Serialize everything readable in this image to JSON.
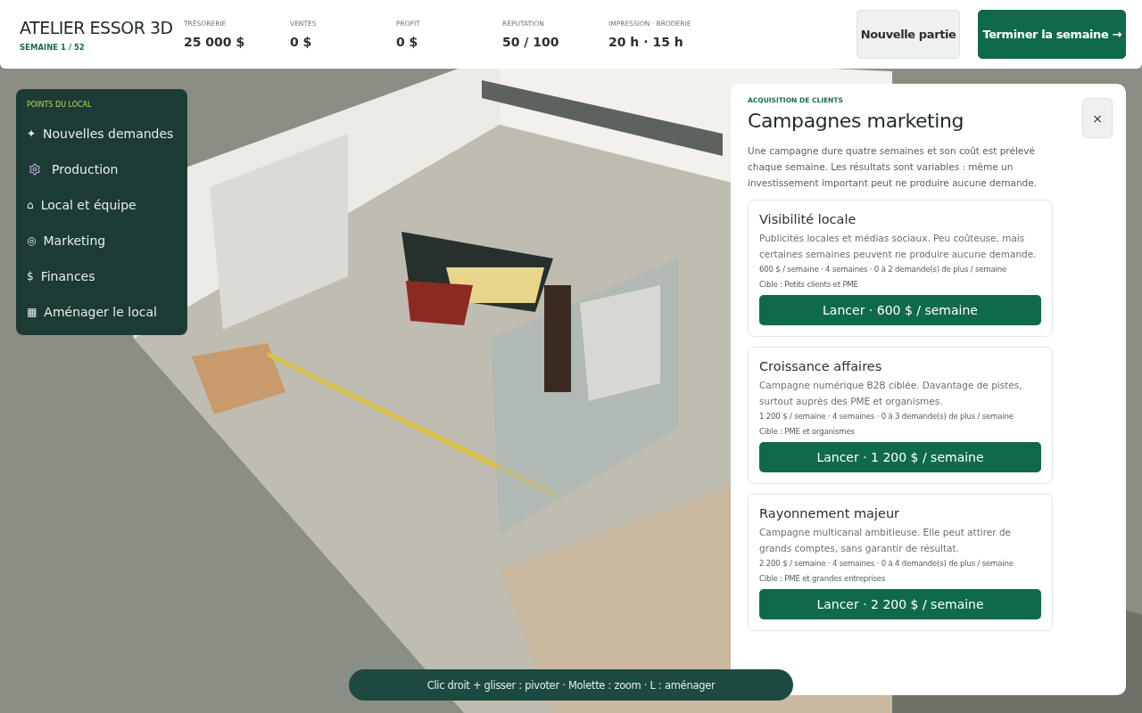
{
  "header": {
    "title": "ATELIER ESSOR 3D",
    "week": "SEMAINE 1 / 52",
    "stats": [
      {
        "label": "TRÉSORERIE",
        "value": "25 000 $"
      },
      {
        "label": "VENTES",
        "value": "0 $"
      },
      {
        "label": "PROFIT",
        "value": "0 $"
      },
      {
        "label": "RÉPUTATION",
        "value": "50 / 100"
      },
      {
        "label": "IMPRESSION · BRODERIE",
        "value": "20 h · 15 h"
      }
    ],
    "buttons": [
      {
        "label": "Nouvelle partie",
        "kind": "secondary"
      },
      {
        "label": "Terminer la semaine →",
        "kind": "primary"
      }
    ]
  },
  "sidebar": {
    "title": "POINTS DU LOCAL",
    "items": [
      {
        "icon": "✦",
        "label": "Nouvelles demandes",
        "kind": "text"
      },
      {
        "label": "Production",
        "kind": "gear"
      },
      {
        "icon": "⌂",
        "label": "Local et équipe",
        "kind": "text"
      },
      {
        "icon": "◎",
        "label": "Marketing",
        "kind": "text"
      },
      {
        "icon": "$",
        "label": "Finances",
        "kind": "text"
      },
      {
        "icon": "▦",
        "label": "Aménager le local",
        "kind": "text"
      }
    ]
  },
  "panel": {
    "eyebrow": "ACQUISITION DE CLIENTS",
    "title": "Campagnes marketing",
    "close": "×",
    "intro": "Une campagne dure quatre semaines et son coût est prélevé chaque semaine. Les résultats sont variables : même un investissement important peut ne produire aucune demande.",
    "campaigns": [
      {
        "name": "Visibilité locale",
        "description": "Publicités locales et médias sociaux. Peu coûteuse, mais certaines semaines peuvent ne produire aucune demande.",
        "details": "600 $ / semaine · 4 semaines · 0 à 2 demande(s) de plus / semaine",
        "target": "Cible : Petits clients et PME",
        "button": "Lancer · 600 $ / semaine"
      },
      {
        "name": "Croissance affaires",
        "description": "Campagne numérique B2B ciblée. Davantage de pistes, surtout auprès des PME et organismes.",
        "details": "1 200 $ / semaine · 4 semaines · 0 à 3 demande(s) de plus / semaine",
        "target": "Cible : PME et organismes",
        "button": "Lancer · 1 200 $ / semaine"
      },
      {
        "name": "Rayonnement majeur",
        "description": "Campagne multicanal ambitieuse. Elle peut attirer de grands comptes, sans garantir de résultat.",
        "details": "2 200 $ / semaine · 4 semaines · 0 à 4 demande(s) de plus / semaine",
        "target": "Cible : PME et grandes entreprises",
        "button": "Lancer · 2 200 $ / semaine"
      }
    ]
  },
  "hint": "Clic droit + glisser : pivoter · Molette : zoom · L : aménager"
}
